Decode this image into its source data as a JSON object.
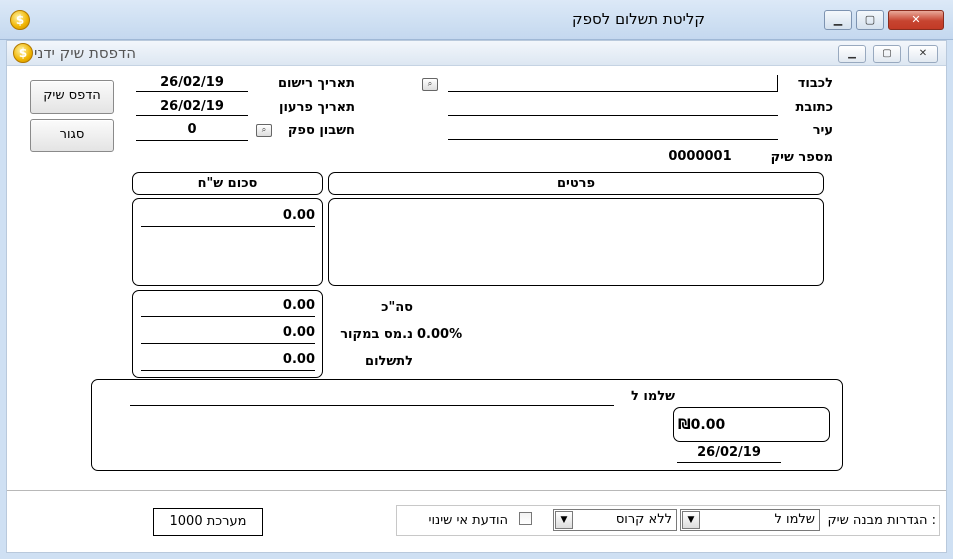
{
  "window": {
    "title": "קליטת תשלום לספק",
    "coin_symbol": "$"
  },
  "child_window": {
    "title": "הדפסת שיק ידני",
    "coin_symbol": "$"
  },
  "buttons": {
    "print_check": "הדפס שיק",
    "close": "סגור"
  },
  "header": {
    "registration_date_label": "תאריך רישום",
    "registration_date": "26/02/19",
    "repayment_date_label": "תאריך פרעון",
    "repayment_date": "26/02/19",
    "supplier_account_label": "חשבון ספק",
    "supplier_account": "0",
    "to_label": "לכבוד",
    "to_value": "",
    "address_label": "כתובת",
    "address_value": "",
    "city_label": "עיר",
    "city_value": "",
    "check_number_label": "מספר שיק",
    "check_number": "0000001"
  },
  "details_table": {
    "col_details": "פרטים",
    "col_amount": "סכום ש\"ח",
    "rows": [
      {
        "details": "",
        "amount": "0.00"
      }
    ]
  },
  "totals": {
    "total_label": "סה\"כ",
    "total_value": "0.00",
    "withholding_label": "נ.מס במקור",
    "withholding_percent": "0.00%",
    "withholding_value": "0.00",
    "to_pay_label": "לתשלום",
    "to_pay_value": "0.00"
  },
  "check_preview": {
    "pay_to_label": "שלמו ל",
    "pay_to_value": "",
    "amount": "₪0.00",
    "date": "26/02/19"
  },
  "footer": {
    "system_label": "מערכת 1000",
    "settings_label": "הגדרות מבנה שיק :",
    "payto_option": "שלמו ל",
    "cross_option": "ללא קרוס",
    "non_transferable_label": "הודעת אי שינוי",
    "non_transferable_checked": false
  }
}
